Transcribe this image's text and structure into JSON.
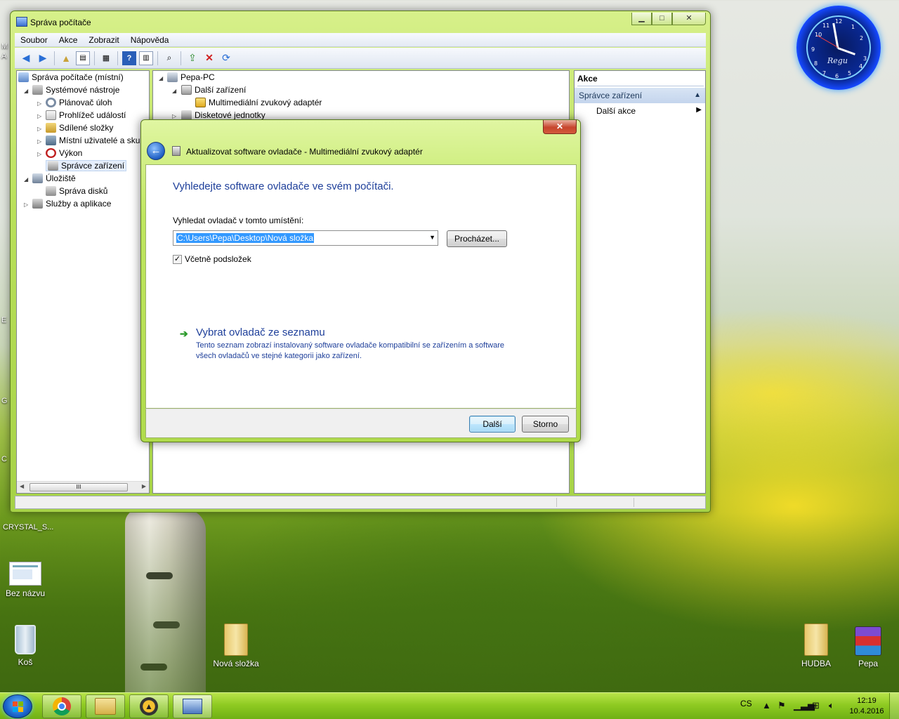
{
  "desktop": {
    "left_edge_labels": [
      "M",
      "A",
      "E",
      "G",
      "C"
    ],
    "crystal_label": "CRYSTAL_S...",
    "icons": [
      {
        "label": "Bez názvu",
        "icon": "image-file-icon"
      },
      {
        "label": "Koš",
        "icon": "recycle-bin-icon"
      },
      {
        "label": "Nová složka",
        "icon": "folder-icon"
      },
      {
        "label": "HUDBA",
        "icon": "folder-icon"
      },
      {
        "label": "Pepa",
        "icon": "winrar-archive-icon"
      }
    ],
    "clock": {
      "brand": "Regu",
      "numbers": [
        "12",
        "1",
        "2",
        "3",
        "4",
        "5",
        "6",
        "7",
        "8",
        "9",
        "10",
        "11"
      ]
    }
  },
  "main_window": {
    "title": "Správa počítače",
    "caption_buttons": {
      "minimize": "▁",
      "maximize": "□",
      "close": "✕"
    },
    "menu": [
      "Soubor",
      "Akce",
      "Zobrazit",
      "Nápověda"
    ],
    "tree": {
      "root": "Správa počítače (místní)",
      "system_tools": "Systémové nástroje",
      "task_scheduler": "Plánovač úloh",
      "event_viewer": "Prohlížeč událostí",
      "shared_folders": "Sdílené složky",
      "local_users": "Místní uživatelé a skup",
      "performance": "Výkon",
      "device_manager": "Správce zařízení",
      "storage": "Úložiště",
      "disk_management": "Správa disků",
      "services": "Služby a aplikace"
    },
    "devices": {
      "computer": "Pepa-PC",
      "other_devices": "Další zařízení",
      "audio_adapter": "Multimediální zvukový adaptér",
      "floppy": "Disketové jednotky"
    },
    "actions": {
      "header": "Akce",
      "section": "Správce zařízení",
      "more": "Další akce"
    },
    "scroll_thumb": "III"
  },
  "dialog": {
    "title": "Aktualizovat software ovladače - Multimediální zvukový adaptér",
    "heading": "Vyhledejte software ovladače ve svém počítači.",
    "field_label": "Vyhledat ovladač v tomto umístění:",
    "path_value": "C:\\Users\\Pepa\\Desktop\\Nová složka",
    "browse_button": "Procházet...",
    "include_subfolders": "Včetně podsložek",
    "include_subfolders_checked": true,
    "pick_link": "Vybrat ovladač ze seznamu",
    "pick_desc": "Tento seznam zobrazí instalovaný software ovladače kompatibilní se zařízením a software všech ovladačů ve stejné kategorii jako zařízení.",
    "next_button": "Další",
    "cancel_button": "Storno"
  },
  "taskbar": {
    "language": "CS",
    "time": "12:19",
    "date": "10.4.2016",
    "pinned": [
      "chrome-icon",
      "explorer-icon",
      "aimp-icon",
      "computer-management-icon"
    ]
  },
  "colors": {
    "accent_green": "#9fd23a",
    "link_blue": "#1e3f9a",
    "selection_blue": "#3399ff"
  }
}
